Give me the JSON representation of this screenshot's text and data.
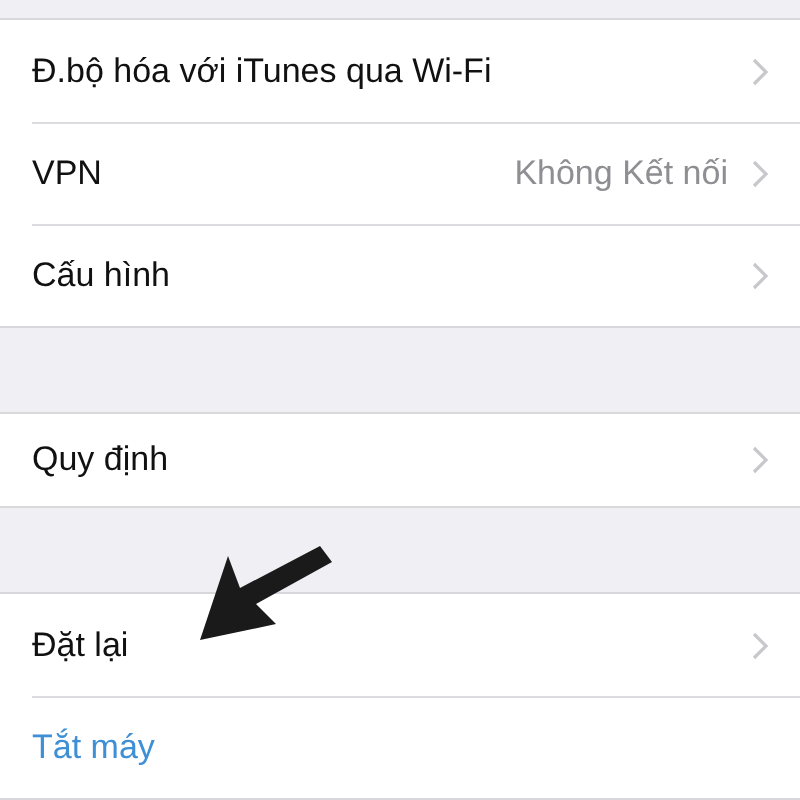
{
  "groups": [
    {
      "rows": [
        {
          "kind": "nav",
          "label": "Đ.bộ hóa với iTunes qua Wi-Fi"
        },
        {
          "kind": "nav",
          "label": "VPN",
          "value": "Không Kết nối"
        },
        {
          "kind": "nav",
          "label": "Cấu hình"
        }
      ]
    },
    {
      "rows": [
        {
          "kind": "nav",
          "label": "Quy định"
        }
      ]
    },
    {
      "rows": [
        {
          "kind": "nav",
          "label": "Đặt lại"
        },
        {
          "kind": "action",
          "label": "Tắt máy"
        }
      ]
    }
  ]
}
